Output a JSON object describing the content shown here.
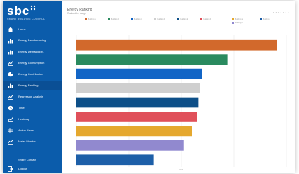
{
  "brand": {
    "logo": "sbc",
    "tagline": "SMART BUILDING CONTROL"
  },
  "sidebar": {
    "items": [
      {
        "label": "Home",
        "icon": "home-icon"
      },
      {
        "label": "Energy Benchmarking",
        "icon": "bar-chart-icon"
      },
      {
        "label": "Energy Demand Ext.",
        "icon": "bar-chart-icon"
      },
      {
        "label": "Energy Consumption",
        "icon": "line-chart-icon"
      },
      {
        "label": "Energy Contribution",
        "icon": "pie-chart-icon"
      },
      {
        "label": "Energy Ranking",
        "icon": "bar-chart-icon"
      },
      {
        "label": "Regression Analysis",
        "icon": "line-chart-icon"
      },
      {
        "label": "Time",
        "icon": "clock-icon"
      },
      {
        "label": "Heatmap",
        "icon": "line-chart-icon"
      },
      {
        "label": "Active Alerts",
        "icon": "table-icon"
      },
      {
        "label": "Meter Monitor",
        "icon": "line-chart-icon"
      }
    ],
    "footer": {
      "share_label": "Share Contact",
      "logout_label": "Logout"
    }
  },
  "header": {
    "title": "Energy Ranking",
    "subtitle": "Ranked by usage",
    "tools": "‹ • • • • • ›"
  },
  "legend": [
    {
      "label": "Building A",
      "color": "#d2692c"
    },
    {
      "label": "Building B",
      "color": "#2a8a5f"
    },
    {
      "label": "Building C",
      "color": "#1265c6"
    },
    {
      "label": "Building D",
      "color": "#cfcfcf"
    },
    {
      "label": "Building E",
      "color": "#0d4f88"
    },
    {
      "label": "Building F",
      "color": "#e0505a"
    },
    {
      "label": "Building G",
      "color": "#e5a82e"
    },
    {
      "label": "Building H",
      "color": "#9189cf"
    },
    {
      "label": "Building I",
      "color": "#1d5fa8"
    }
  ],
  "chart_data": {
    "type": "bar",
    "orientation": "horizontal",
    "categories": [
      "Building A",
      "Building B",
      "Building C",
      "Building D",
      "Building E",
      "Building F",
      "Building G",
      "Building H",
      "Building I"
    ],
    "values": [
      1530,
      1150,
      960,
      940,
      930,
      920,
      880,
      820,
      590
    ],
    "colors": [
      "#d2692c",
      "#2a8a5f",
      "#1265c6",
      "#cfcfcf",
      "#0d4f88",
      "#e0505a",
      "#e5a82e",
      "#9189cf",
      "#1d5fa8"
    ],
    "xlim": [
      0,
      1600
    ],
    "x_gridlines": [
      0,
      400,
      800,
      1200,
      1600
    ],
    "xlabel": "kWh"
  }
}
